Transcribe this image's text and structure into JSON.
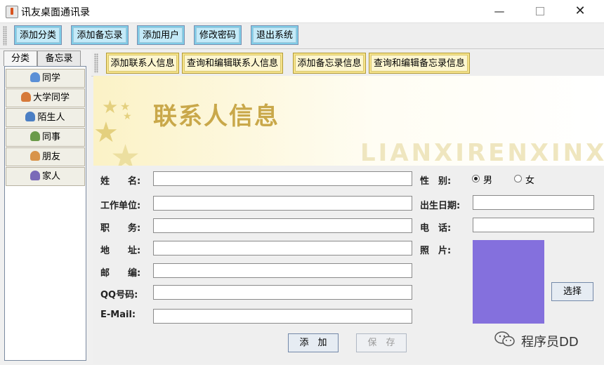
{
  "window": {
    "title": "讯友桌面通讯录"
  },
  "toolbar": {
    "buttons": [
      "添加分类",
      "添加备忘录",
      "添加用户",
      "修改密码",
      "退出系统"
    ]
  },
  "left": {
    "tabs": [
      "分类",
      "备忘录"
    ],
    "categories": [
      "同学",
      "大学同学",
      "陌生人",
      "同事",
      "朋友",
      "家人"
    ]
  },
  "subtoolbar": {
    "buttons": [
      "添加联系人信息",
      "查询和编辑联系人信息",
      "添加备忘录信息",
      "查询和编辑备忘录信息"
    ]
  },
  "banner": {
    "title": "联系人信息",
    "pinyin": "LIANXIRENXINXI"
  },
  "form": {
    "name_label": "姓　　名:",
    "company_label": "工作单位:",
    "position_label": "职　　务:",
    "address_label": "地　　址:",
    "postcode_label": "邮　　编:",
    "qq_label": "QQ号码:",
    "email_label": "E-Mail:",
    "gender_label": "性　别:",
    "gender_male": "男",
    "gender_female": "女",
    "gender_selected": "男",
    "birthday_label": "出生日期:",
    "phone_label": "电　话:",
    "photo_label": "照　片:",
    "choose_button": "选择",
    "add_button": "添　加",
    "save_button": "保　存"
  },
  "watermark": {
    "text": "程序员DD"
  },
  "colors": {
    "toolbar_button": "#7ecce7",
    "subtoolbar_button": "#f6e38a",
    "photo_placeholder": "#8470dd",
    "banner_title": "#c9a84a"
  }
}
